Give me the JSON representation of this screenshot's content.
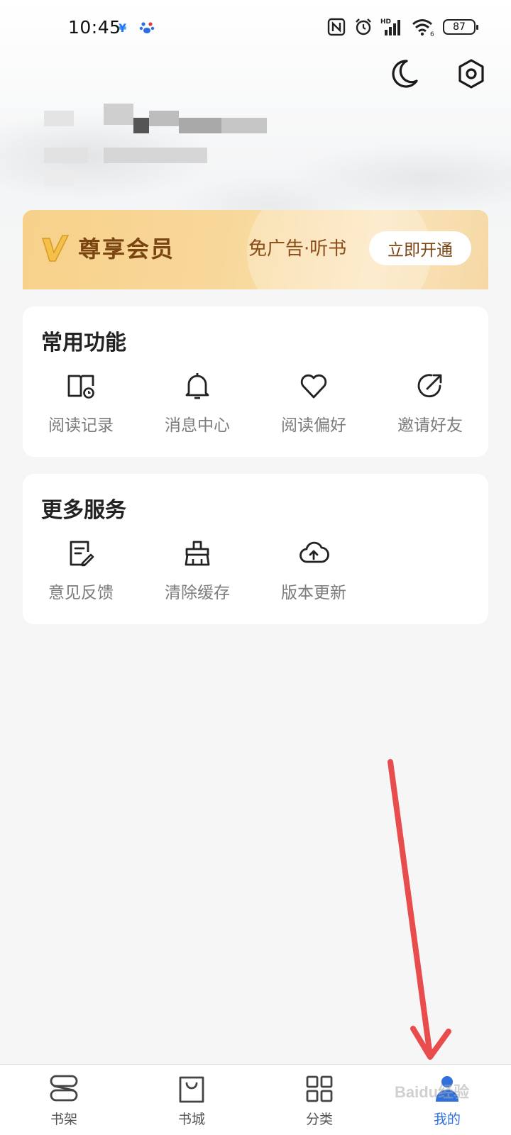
{
  "status_bar": {
    "time": "10:45",
    "app_icons": [
      "alipay-icon",
      "baidu-paw-icon"
    ],
    "right_icons": [
      "nfc-icon",
      "alarm-icon",
      "signal-hd-icon",
      "wifi-icon"
    ],
    "signal_badge": "HD",
    "wifi_badge": "6",
    "battery": "87"
  },
  "header": {
    "actions": [
      "night-mode-icon",
      "settings-icon"
    ]
  },
  "vip": {
    "title": "尊享会员",
    "benefits": "免广告·听书",
    "button": "立即开通",
    "colors": {
      "gradient_start": "#f7d18a",
      "gradient_end": "#fbe5bd",
      "text": "#7a4512"
    }
  },
  "common": {
    "title": "常用功能",
    "items": [
      {
        "label": "阅读记录",
        "icon": "reading-history-icon"
      },
      {
        "label": "消息中心",
        "icon": "bell-icon"
      },
      {
        "label": "阅读偏好",
        "icon": "heart-icon"
      },
      {
        "label": "邀请好友",
        "icon": "share-icon"
      }
    ]
  },
  "more": {
    "title": "更多服务",
    "items": [
      {
        "label": "意见反馈",
        "icon": "feedback-icon"
      },
      {
        "label": "清除缓存",
        "icon": "broom-icon"
      },
      {
        "label": "版本更新",
        "icon": "cloud-upload-icon"
      }
    ]
  },
  "bottom_nav": {
    "items": [
      {
        "label": "书架",
        "icon": "bookshelf-icon"
      },
      {
        "label": "书城",
        "icon": "bookstore-icon"
      },
      {
        "label": "分类",
        "icon": "category-grid-icon"
      },
      {
        "label": "我的",
        "icon": "profile-icon",
        "active": true
      }
    ],
    "active_color": "#2f6fde"
  },
  "watermark": "Baidu经验"
}
